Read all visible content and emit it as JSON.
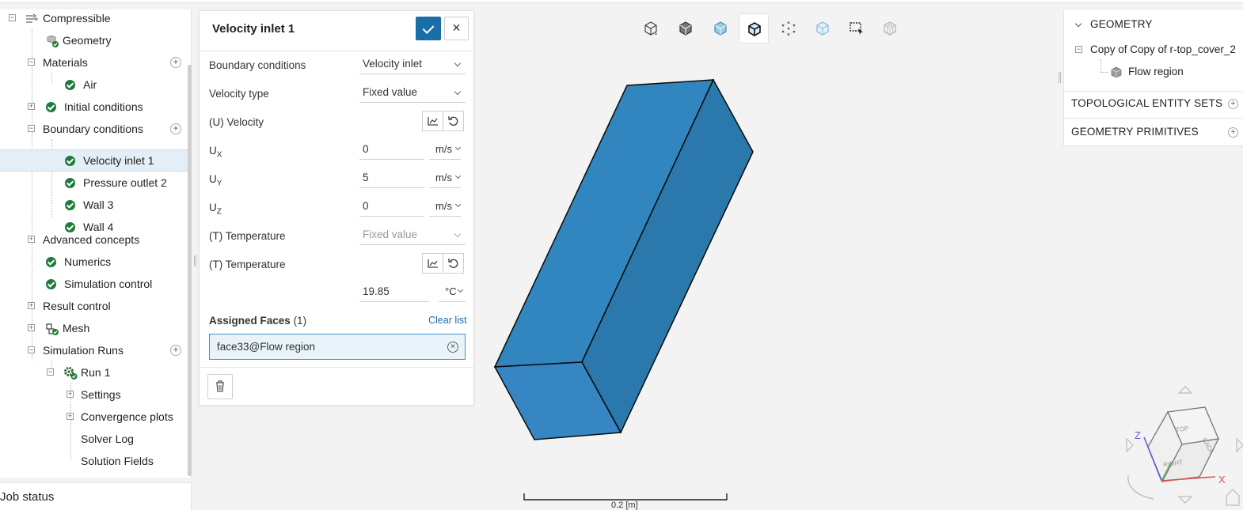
{
  "tree": {
    "items": [
      {
        "label": "Compressible"
      },
      {
        "label": "Geometry"
      },
      {
        "label": "Materials"
      },
      {
        "label": "Air"
      },
      {
        "label": "Initial conditions"
      },
      {
        "label": "Boundary conditions"
      },
      {
        "label": "Velocity inlet 1"
      },
      {
        "label": "Pressure outlet 2"
      },
      {
        "label": "Wall 3"
      },
      {
        "label": "Wall 4"
      },
      {
        "label": "Advanced concepts"
      },
      {
        "label": "Numerics"
      },
      {
        "label": "Simulation control"
      },
      {
        "label": "Result control"
      },
      {
        "label": "Mesh"
      },
      {
        "label": "Simulation Runs"
      },
      {
        "label": "Run 1"
      },
      {
        "label": "Settings"
      },
      {
        "label": "Convergence plots"
      },
      {
        "label": "Solver Log"
      },
      {
        "label": "Solution Fields"
      }
    ],
    "job_status": "Job status"
  },
  "dialog": {
    "title": "Velocity inlet 1",
    "fields": {
      "bc_label": "Boundary conditions",
      "bc_value": "Velocity inlet",
      "vtype_label": "Velocity type",
      "vtype_value": "Fixed value",
      "velocity_label": "(U) Velocity",
      "ux_label": "U",
      "ux_sub": "X",
      "ux_value": "0",
      "ux_unit": "m/s",
      "uy_label": "U",
      "uy_sub": "Y",
      "uy_value": "5",
      "uy_unit": "m/s",
      "uz_label": "U",
      "uz_sub": "Z",
      "uz_value": "0",
      "uz_unit": "m/s",
      "ttype_label": "(T) Temperature",
      "ttype_value": "Fixed value",
      "temp_label": "(T) Temperature",
      "temp_value": "19.85",
      "temp_unit": "°C"
    },
    "assigned_label": "Assigned Faces",
    "assigned_count": "(1)",
    "clear_label": "Clear list",
    "face": "face33@Flow region"
  },
  "geometry_panel": {
    "header": "GEOMETRY",
    "item": "Copy of Copy of r-top_cover_2",
    "subitem": "Flow region",
    "section1": "TOPOLOGICAL ENTITY SETS",
    "section2": "GEOMETRY PRIMITIVES"
  },
  "viewer": {
    "scale_label": "0.2 [m]",
    "cube_labels": {
      "top": "TOP",
      "right": "RIGHT",
      "back": "BACK"
    },
    "axis_labels": {
      "z": "Z",
      "x": "X"
    },
    "colors": {
      "body": "#2f7db3",
      "accent": "#1a6ea8",
      "ok": "#1e7b3a"
    }
  }
}
